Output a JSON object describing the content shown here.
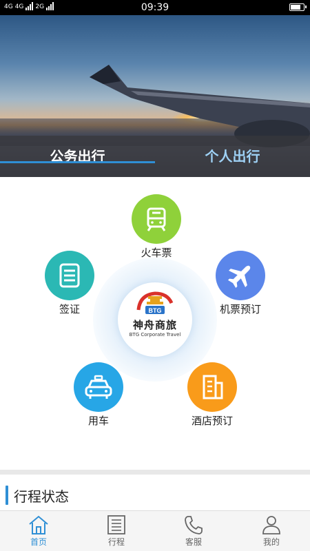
{
  "status_bar": {
    "network_left": "4G",
    "network_mid": "4G",
    "network_right": "2G",
    "time": "09:39",
    "battery_level": 0.85
  },
  "hero": {
    "tabs": [
      {
        "label": "公务出行",
        "active": true
      },
      {
        "label": "个人出行",
        "active": false
      }
    ],
    "active_tab_color": "#2f8fd5"
  },
  "logo": {
    "badge_text": "BTG",
    "name": "神舟商旅",
    "subtitle": "BTG Corporate Travel"
  },
  "services": [
    {
      "id": "train",
      "label": "火车票",
      "icon": "train-icon",
      "color": "#8fd13a"
    },
    {
      "id": "visa",
      "label": "签证",
      "icon": "document-list-icon",
      "color": "#2bb8b4"
    },
    {
      "id": "flight",
      "label": "机票预订",
      "icon": "airplane-icon",
      "color": "#5b86ea"
    },
    {
      "id": "car",
      "label": "用车",
      "icon": "taxi-icon",
      "color": "#27a6e6"
    },
    {
      "id": "hotel",
      "label": "酒店预订",
      "icon": "building-icon",
      "color": "#f99b1a"
    }
  ],
  "trip_status": {
    "title": "行程状态"
  },
  "bottom_nav": [
    {
      "label": "首页",
      "icon": "home-icon",
      "active": true
    },
    {
      "label": "行程",
      "icon": "itinerary-icon",
      "active": false
    },
    {
      "label": "客服",
      "icon": "phone-icon",
      "active": false
    },
    {
      "label": "我的",
      "icon": "user-icon",
      "active": false
    }
  ]
}
